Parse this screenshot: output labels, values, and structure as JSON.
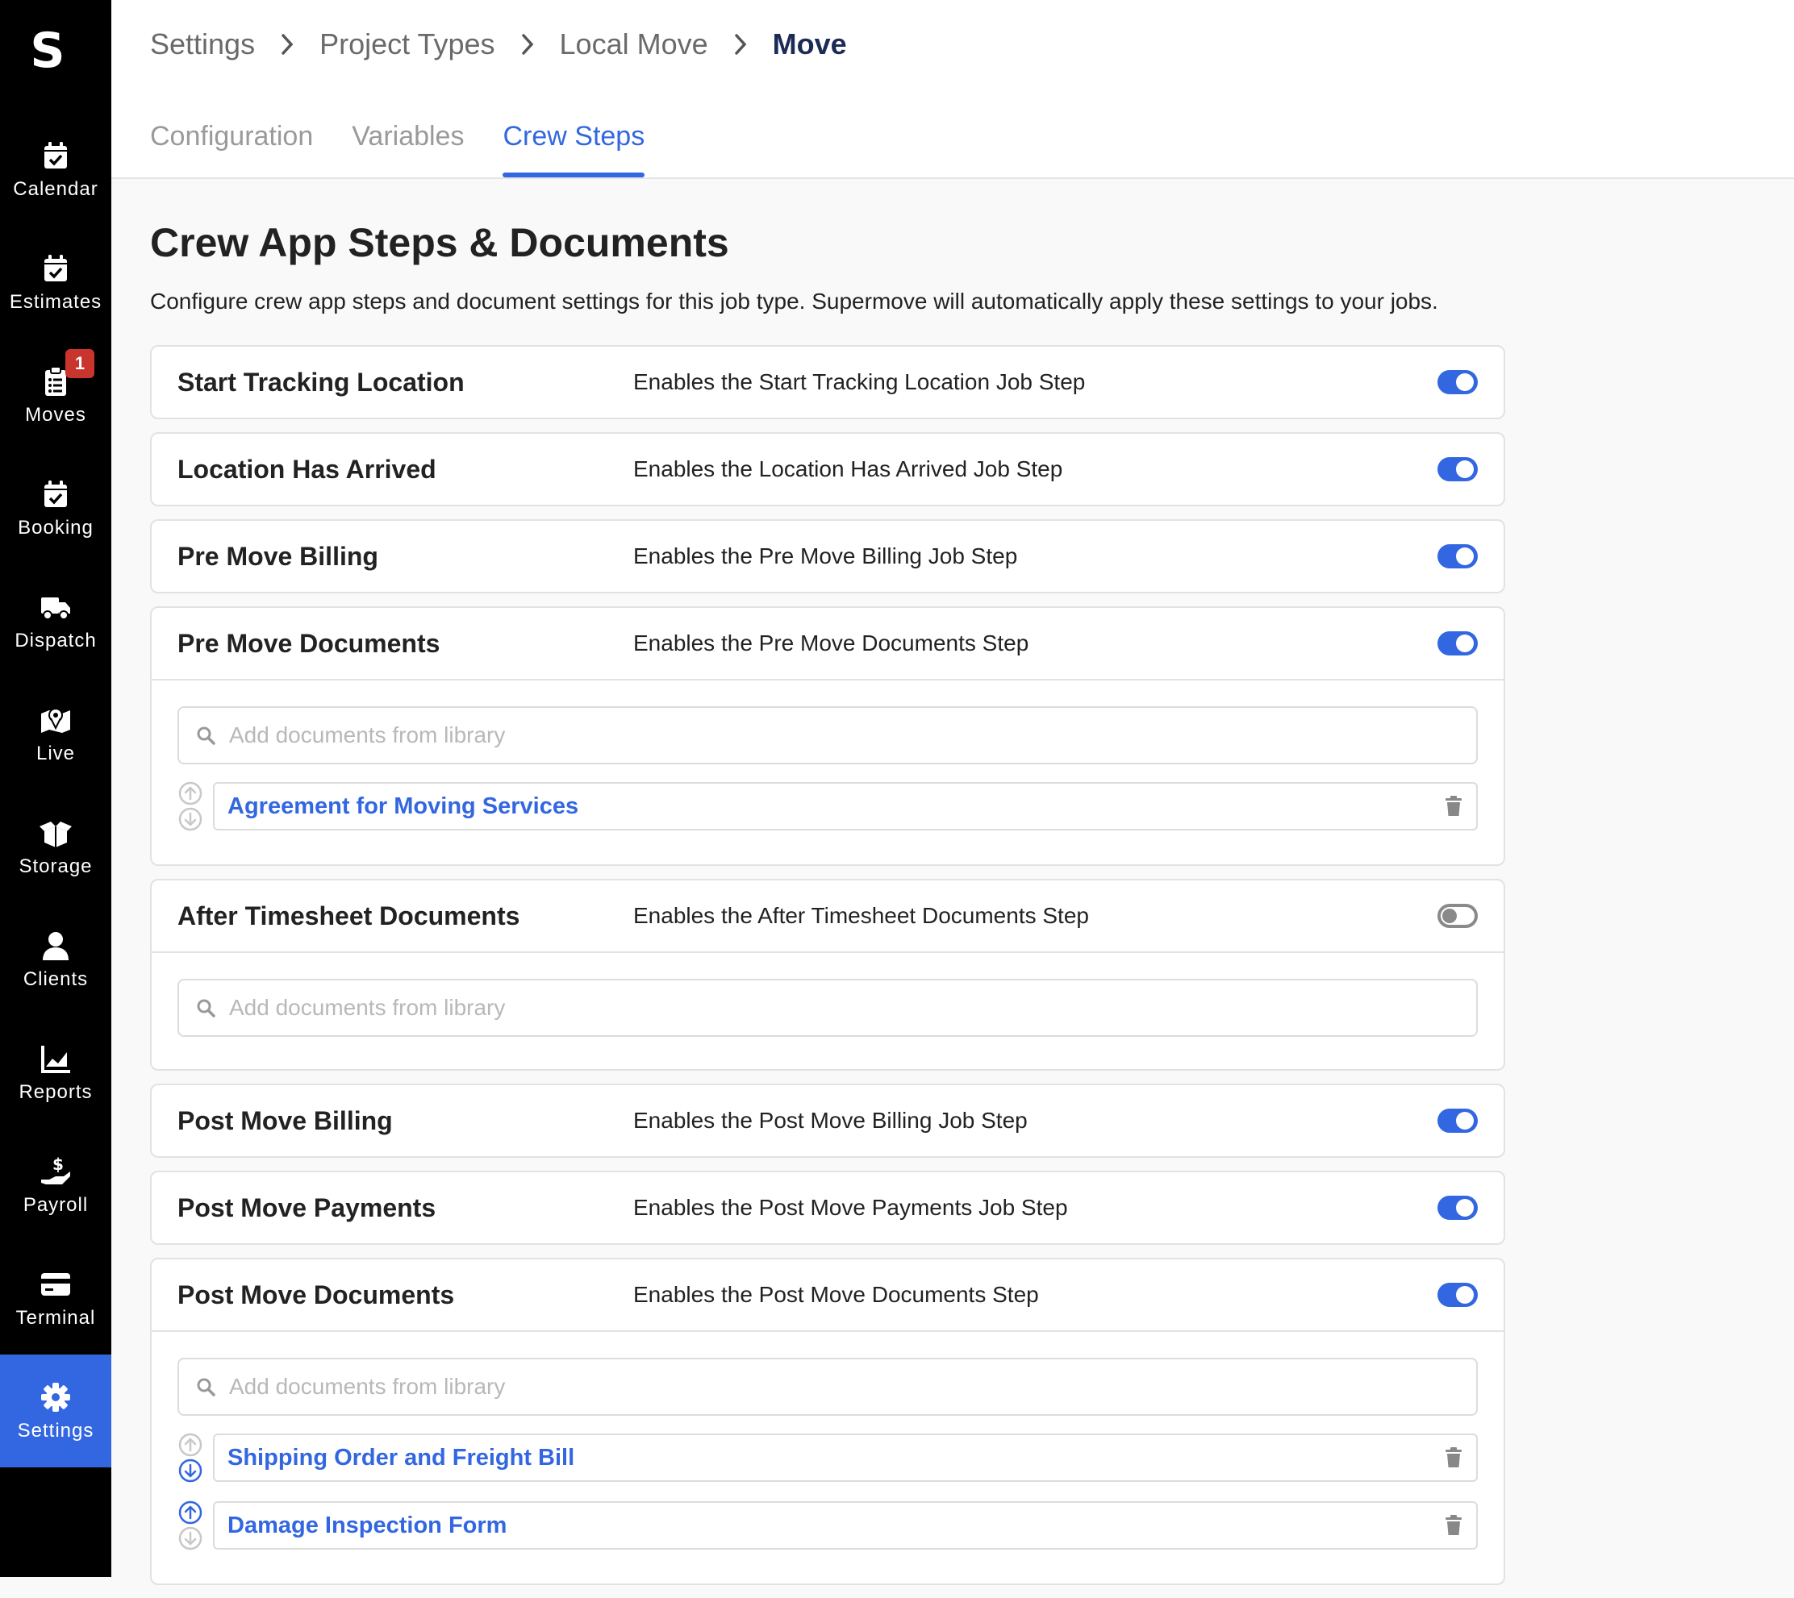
{
  "app": {
    "logo": "S"
  },
  "sidebar": {
    "items": [
      {
        "label": "Calendar",
        "icon": "calendar-check-icon"
      },
      {
        "label": "Estimates",
        "icon": "calendar-check-icon"
      },
      {
        "label": "Moves",
        "icon": "clipboard-list-icon",
        "badge": "1"
      },
      {
        "label": "Booking",
        "icon": "calendar-check-icon"
      },
      {
        "label": "Dispatch",
        "icon": "truck-icon"
      },
      {
        "label": "Live",
        "icon": "map-marker-icon"
      },
      {
        "label": "Storage",
        "icon": "box-open-icon"
      },
      {
        "label": "Clients",
        "icon": "user-icon"
      },
      {
        "label": "Reports",
        "icon": "chart-area-icon"
      },
      {
        "label": "Payroll",
        "icon": "hand-dollar-icon"
      },
      {
        "label": "Terminal",
        "icon": "credit-card-icon"
      },
      {
        "label": "Settings",
        "icon": "gear-icon",
        "active": true
      }
    ]
  },
  "breadcrumb": [
    "Settings",
    "Project Types",
    "Local Move",
    "Move"
  ],
  "tabs": [
    {
      "label": "Configuration"
    },
    {
      "label": "Variables"
    },
    {
      "label": "Crew Steps",
      "active": true
    }
  ],
  "page": {
    "title": "Crew App Steps & Documents",
    "description": "Configure crew app steps and document settings for this job type. Supermove will automatically apply these settings to your jobs."
  },
  "search_placeholder": "Add documents from library",
  "steps": [
    {
      "title": "Start Tracking Location",
      "description": "Enables the Start Tracking Location Job Step",
      "enabled": true
    },
    {
      "title": "Location Has Arrived",
      "description": "Enables the Location Has Arrived Job Step",
      "enabled": true
    },
    {
      "title": "Pre Move Billing",
      "description": "Enables the Pre Move Billing Job Step",
      "enabled": true
    },
    {
      "title": "Pre Move Documents",
      "description": "Enables the Pre Move Documents Step",
      "enabled": true,
      "documents": [
        "Agreement for Moving Services"
      ]
    },
    {
      "title": "After Timesheet Documents",
      "description": "Enables the After Timesheet Documents Step",
      "enabled": false,
      "documents": []
    },
    {
      "title": "Post Move Billing",
      "description": "Enables the Post Move Billing Job Step",
      "enabled": true
    },
    {
      "title": "Post Move Payments",
      "description": "Enables the Post Move Payments Job Step",
      "enabled": true
    },
    {
      "title": "Post Move Documents",
      "description": "Enables the Post Move Documents Step",
      "enabled": true,
      "documents": [
        "Shipping Order and Freight Bill",
        "Damage Inspection Form"
      ]
    }
  ],
  "colors": {
    "accent": "#3367e1",
    "sidebar_bg": "#000000",
    "badge": "#c9352d",
    "breadcrumb_current": "#1c2b55"
  }
}
